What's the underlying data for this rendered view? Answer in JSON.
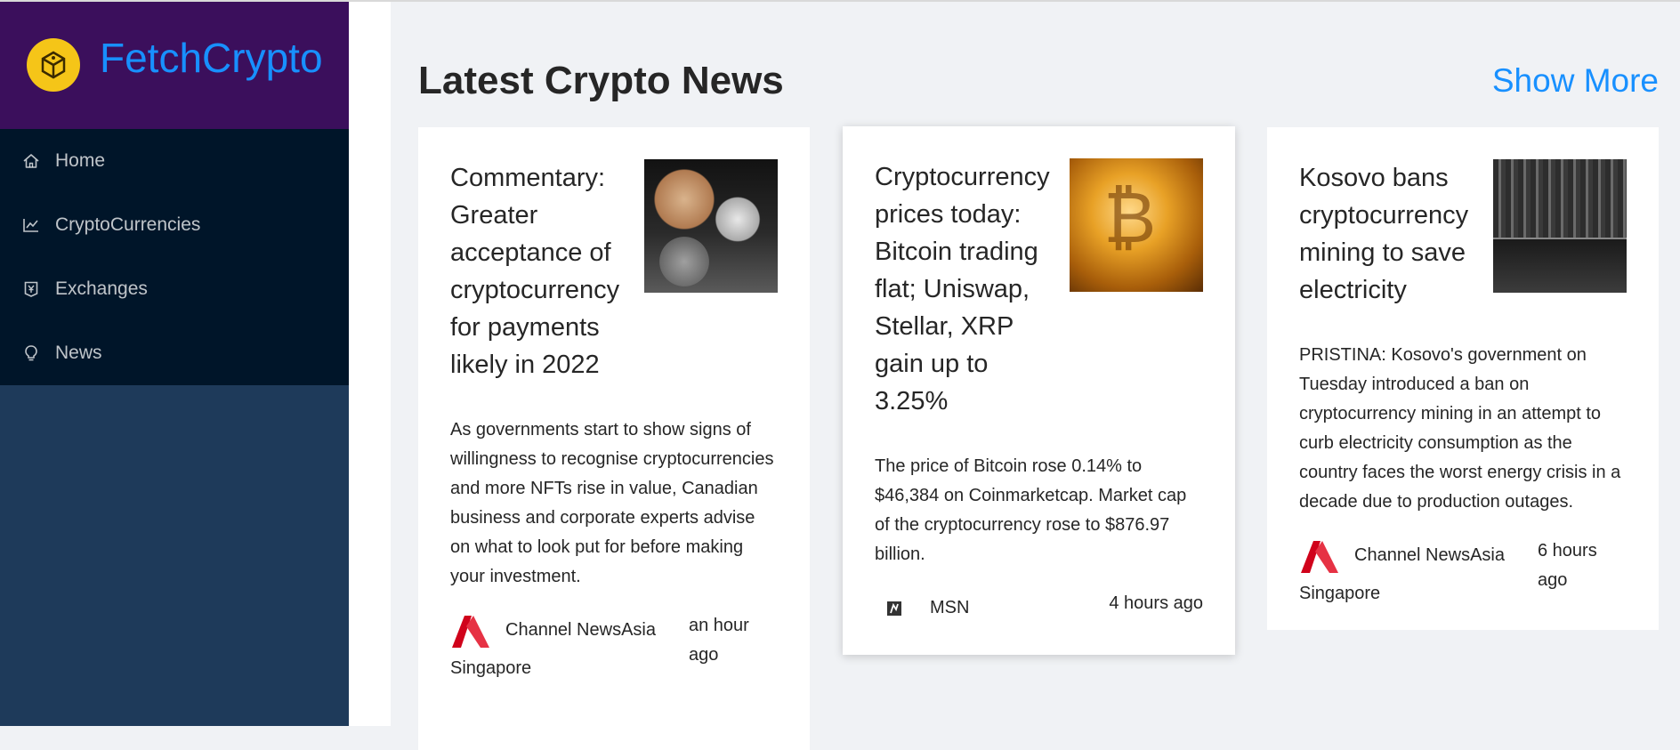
{
  "sidebar": {
    "brand": "FetchCrypto",
    "items": [
      {
        "label": "Home",
        "icon": "home-icon"
      },
      {
        "label": "CryptoCurrencies",
        "icon": "line-chart-icon"
      },
      {
        "label": "Exchanges",
        "icon": "money-collect-icon"
      },
      {
        "label": "News",
        "icon": "bulb-icon"
      }
    ]
  },
  "main": {
    "title": "Latest Crypto News",
    "show_more": "Show More",
    "cards": [
      {
        "title": "Commentary: Greater acceptance of cryptocurrency for payments likely in 2022",
        "description": "As governments start to show signs of willingness to recognise cryptocurrencies and more NFTs rise in value, Canadian business and corporate experts advise on what to look put for before making your investment.",
        "provider": "Channel NewsAsia Singapore",
        "time": "an hour ago"
      },
      {
        "title": "Cryptocurrency prices today: Bitcoin trading flat; Uniswap, Stellar, XRP gain up to 3.25%",
        "description": "The price of Bitcoin rose 0.14% to $46,384 on Coinmarketcap. Market cap of the cryptocurrency rose to $876.97 billion.",
        "provider": "MSN",
        "time": "4 hours ago"
      },
      {
        "title": "Kosovo bans cryptocurrency mining to save electricity",
        "description": "PRISTINA: Kosovo's government on Tuesday introduced a ban on cryptocurrency mining in an attempt to curb electricity consumption as the country faces the worst energy crisis in a decade due to production outages.",
        "provider": "Channel NewsAsia Singapore",
        "time": "6 hours ago"
      }
    ]
  },
  "colors": {
    "brand_bg": "#3b0f5c",
    "accent": "#1890ff",
    "menu_bg": "#001529",
    "sidebar_bg": "#1e3a5a",
    "logo_yellow": "#f5c518",
    "cna_red": "#d0021b"
  }
}
